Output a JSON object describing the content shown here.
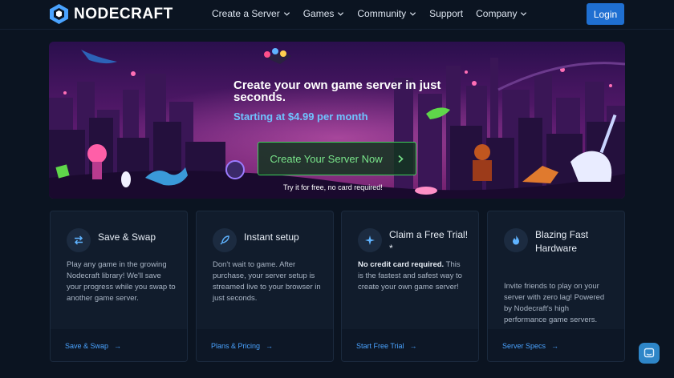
{
  "nav": {
    "brand": "NODECRAFT",
    "items": [
      {
        "label": "Create a Server",
        "has_dropdown": true
      },
      {
        "label": "Games",
        "has_dropdown": true
      },
      {
        "label": "Community",
        "has_dropdown": true
      },
      {
        "label": "Support",
        "has_dropdown": false
      },
      {
        "label": "Company",
        "has_dropdown": true
      }
    ],
    "login_label": "Login"
  },
  "hero": {
    "title": "Create your own game server in just seconds.",
    "subtitle": "Starting at $4.99 per month",
    "cta_label": "Create Your Server Now",
    "note": "Try it for free, no card required!"
  },
  "cards": [
    {
      "title": "Save & Swap",
      "icon": "swap-arrows-icon",
      "desc_bold": "",
      "desc": "Play any game in the growing Nodecraft library! We'll save your progress while you swap to another game server.",
      "link": "Save & Swap"
    },
    {
      "title": "Instant setup",
      "icon": "rocket-icon",
      "desc_bold": "",
      "desc": "Don't wait to game. After purchase, your server setup is streamed live to your browser in just seconds.",
      "link": "Plans & Pricing"
    },
    {
      "title": "Claim a Free Trial! *",
      "icon": "sparkle-icon",
      "desc_bold": "No credit card required.",
      "desc": " This is the fastest and safest way to create your own game server!",
      "link": "Start Free Trial"
    },
    {
      "title": "Blazing Fast Hardware",
      "icon": "flame-icon",
      "desc_bold": "",
      "desc": "Invite friends to play on your server with zero lag! Powered by Nodecraft's high performance game servers.",
      "link": "Server Specs"
    }
  ],
  "colors": {
    "accent": "#1f6fd1",
    "cta_green": "#3fd05c",
    "link": "#4aa3ff",
    "background": "#0b1421"
  }
}
